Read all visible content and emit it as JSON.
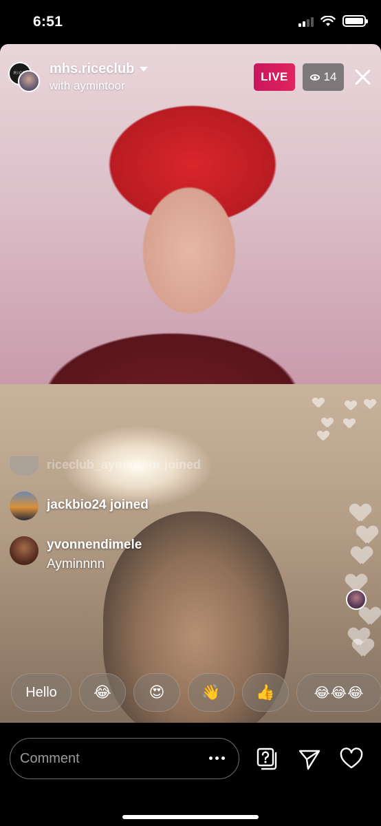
{
  "status_bar": {
    "time": "6:51"
  },
  "header": {
    "host_username": "mhs.riceclub",
    "avatar_text": "RICE",
    "guest_line": "with aymintoor",
    "live_label": "LIVE",
    "viewer_count": "14"
  },
  "comments": {
    "faded_text": "riceclub_aymintoor joined",
    "items": [
      {
        "username": "jackbio24 joined",
        "message": ""
      },
      {
        "username": "yvonnendimele",
        "message": "Ayminnnn"
      }
    ]
  },
  "reactions": {
    "items": [
      {
        "label": "Hello"
      },
      {
        "label": "😂"
      },
      {
        "label": "😍"
      },
      {
        "label": "👋"
      },
      {
        "label": "👍"
      },
      {
        "label": "😂😂😂"
      }
    ]
  },
  "composer": {
    "placeholder": "Comment"
  },
  "colors": {
    "live_badge": "#e0245e",
    "viewer_badge": "#5a5a5a",
    "background": "#000000"
  },
  "icons": [
    "caret-down-icon",
    "eye-icon",
    "close-icon",
    "more-dots-icon",
    "question-icon",
    "send-icon",
    "heart-icon"
  ]
}
